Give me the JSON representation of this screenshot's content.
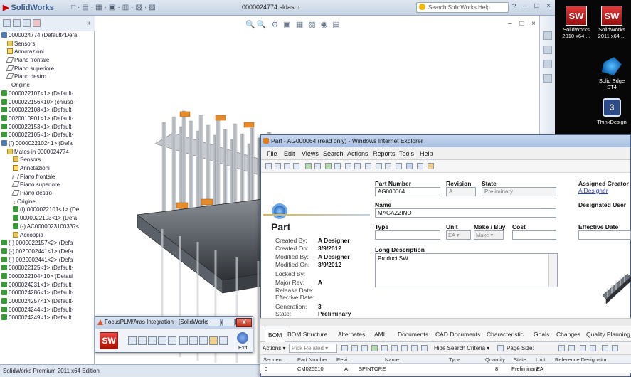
{
  "solidworks": {
    "app_logo": "SolidWorks",
    "quick_access": "□·▤·▦·▣·▥·▧·▨",
    "document_title": "0000024774.sldasm",
    "search_placeholder": "Search SolidWorks Help",
    "help_label": "?",
    "window_controls": "– □ ×",
    "viewport_toolbar": "🔍🔍 ⚙ ▣ ▦ ▧ ◉ ▤",
    "viewport_controls": "– □ ×",
    "fm_chevron": "»",
    "status_bar": "SolidWorks Premium 2011 x64 Edition",
    "feature_tree": [
      {
        "icon": "ic-sub",
        "indent": 0,
        "label": "0000024774  (Default<Defa"
      },
      {
        "icon": "ic-folder",
        "indent": 1,
        "label": "Sensors"
      },
      {
        "icon": "ic-anno",
        "indent": 1,
        "label": "Annotazioni"
      },
      {
        "icon": "ic-plane",
        "indent": 1,
        "label": "Piano frontale"
      },
      {
        "icon": "ic-plane",
        "indent": 1,
        "label": "Piano superiore"
      },
      {
        "icon": "ic-plane",
        "indent": 1,
        "label": "Piano destro"
      },
      {
        "icon": "ic-orig",
        "indent": 1,
        "label": "Origine"
      },
      {
        "icon": "ic-part",
        "indent": 0,
        "label": "0000022107<1> (Default-"
      },
      {
        "icon": "ic-part",
        "indent": 0,
        "label": "0000022156<10> (chiuso-"
      },
      {
        "icon": "ic-part",
        "indent": 0,
        "label": "0000022108<1> (Default-"
      },
      {
        "icon": "ic-part",
        "indent": 0,
        "label": "0020010901<1> (Default-"
      },
      {
        "icon": "ic-part",
        "indent": 0,
        "label": "0000022153<1> (Default-"
      },
      {
        "icon": "ic-part",
        "indent": 0,
        "label": "0000022105<1> (Default-"
      },
      {
        "icon": "ic-sub",
        "indent": 0,
        "label": "(f) 0000022102<1> (Defa"
      },
      {
        "icon": "ic-folder",
        "indent": 1,
        "label": "Mates in 0000024774"
      },
      {
        "icon": "ic-folder",
        "indent": 2,
        "label": "Sensors"
      },
      {
        "icon": "ic-anno",
        "indent": 2,
        "label": "Annotazioni"
      },
      {
        "icon": "ic-plane",
        "indent": 2,
        "label": "Piano frontale"
      },
      {
        "icon": "ic-plane",
        "indent": 2,
        "label": "Piano superiore"
      },
      {
        "icon": "ic-plane",
        "indent": 2,
        "label": "Piano destro"
      },
      {
        "icon": "ic-orig",
        "indent": 2,
        "label": "Origine"
      },
      {
        "icon": "ic-part",
        "indent": 2,
        "label": "(f) 0000022101<1> (De"
      },
      {
        "icon": "ic-part",
        "indent": 2,
        "label": "0000022103<1> (Defa"
      },
      {
        "icon": "ic-part",
        "indent": 2,
        "label": "(-) AC000002310033?<"
      },
      {
        "icon": "ic-folder",
        "indent": 2,
        "label": "Accoppia"
      },
      {
        "icon": "ic-part",
        "indent": 0,
        "label": "(-) 0000022157<2> (Defa"
      },
      {
        "icon": "ic-part",
        "indent": 0,
        "label": "(-) 0020002441<1> (Defa"
      },
      {
        "icon": "ic-part",
        "indent": 0,
        "label": "(-) 0020002441<2> (Defa"
      },
      {
        "icon": "ic-part",
        "indent": 0,
        "label": "0000022125<1> (Default-"
      },
      {
        "icon": "ic-part",
        "indent": 0,
        "label": "0000022104<10> (Defaul"
      },
      {
        "icon": "ic-part",
        "indent": 0,
        "label": "0000024231<1> (Default-"
      },
      {
        "icon": "ic-part",
        "indent": 0,
        "label": "0000024286<1> (Default-"
      },
      {
        "icon": "ic-part",
        "indent": 0,
        "label": "0000024257<1> (Default-"
      },
      {
        "icon": "ic-part",
        "indent": 0,
        "label": "0000024244<1> (Default-"
      },
      {
        "icon": "ic-part",
        "indent": 0,
        "label": "0000024249<1> (Default"
      }
    ]
  },
  "desktop": {
    "icons": [
      {
        "label": "SolidWorks 2010 x64 ...",
        "tile": "SW"
      },
      {
        "label": "SolidWorks 2011 x64 ...",
        "tile": "SW"
      },
      {
        "label": "Solid Edge ST4",
        "tile": ""
      },
      {
        "label": "ThinkDesign",
        "tile": "3"
      }
    ],
    "ie_minimized_controls": "– □"
  },
  "plm_window": {
    "title": "FocusPLM/Aras Integration - [SolidWorks [Designer]] (Non risponde)",
    "close_glyph": "X",
    "sw_button": "SW",
    "exit_label": "Exit"
  },
  "ie_window": {
    "title": "Part - AG000064 (read only) - Windows Internet Explorer",
    "menu": [
      "File",
      "Edit",
      "Views",
      "Search",
      "Actions",
      "Reports",
      "Tools",
      "Help"
    ],
    "form": {
      "heading": "Part",
      "part_number_label": "Part Number",
      "part_number": "AG000064",
      "revision_label": "Revision",
      "revision": "A",
      "state_label": "State",
      "state": "Preliminary",
      "name_label": "Name",
      "name": "MAGAZZINO",
      "type_label": "Type",
      "unit_label": "Unit",
      "unit": "EA",
      "make_buy_label": "Make / Buy",
      "make_buy": "Make",
      "cost_label": "Cost",
      "long_desc_label": "Long Description",
      "long_desc": "Product SW",
      "assigned_creator_label": "Assigned Creator",
      "assigned_creator": "A Designer",
      "designated_user_label": "Designated User",
      "effective_date_label": "Effective Date",
      "info": [
        {
          "label": "Created By:",
          "value": "A Designer"
        },
        {
          "label": "Created On:",
          "value": "3/9/2012"
        },
        {
          "label": "Modified By:",
          "value": "A Designer"
        },
        {
          "label": "Modified On:",
          "value": "3/9/2012"
        },
        {
          "label": "Locked By:",
          "value": ""
        },
        {
          "label": "Major Rev:",
          "value": "A"
        },
        {
          "label": "Release Date:",
          "value": ""
        },
        {
          "label": "Effective Date:",
          "value": ""
        },
        {
          "label": "Generation:",
          "value": "3"
        },
        {
          "label": "State:",
          "value": "Preliminary"
        }
      ]
    },
    "tabs": [
      "BOM",
      "BOM Structure",
      "Alternates",
      "AML",
      "Documents",
      "CAD Documents",
      "Characteristic",
      "Goals",
      "Changes",
      "Quality Planning"
    ],
    "relationship_toolbar": {
      "actions_label": "Actions ▾",
      "pick_related": "Pick Related",
      "hide_search": "Hide Search Criteria ▾",
      "page_size_label": "Page Size:"
    },
    "grid_columns": [
      "Sequen...",
      "Part Number",
      "Revi...",
      "Name",
      "Type",
      "Quantity",
      "State",
      "Unit",
      "Reference Designator"
    ],
    "grid_rows": [
      {
        "seq": "0",
        "part_number": "CM025510",
        "rev": "A",
        "name": "SPINTORE",
        "type": "",
        "qty": "8",
        "state": "Preliminary",
        "unit": "EA",
        "ref": ""
      }
    ]
  }
}
